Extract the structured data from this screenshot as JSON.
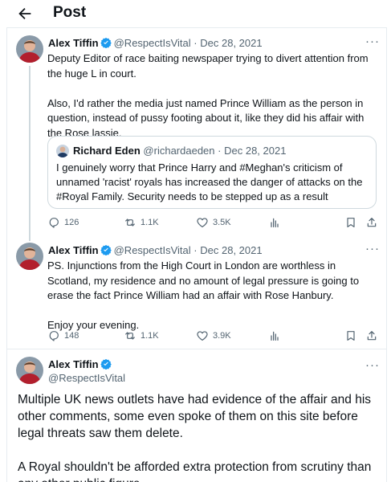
{
  "header": {
    "title": "Post"
  },
  "tweets": [
    {
      "name": "Alex Tiffin",
      "handle": "@RespectIsVital",
      "separator": "·",
      "date": "Dec 28, 2021",
      "text": "Deputy Editor of race baiting newspaper trying to divert attention from the huge L in court.\n\nAlso, I'd rather the media just named Prince William as the person in question, instead of pussy footing about it, like they did his affair with the Rose lassie.",
      "quote": {
        "name": "Richard Eden",
        "handle": "@richardaeden",
        "separator": "·",
        "date": "Dec 28, 2021",
        "text": "I genuinely worry that Prince Harry and #Meghan's criticism of unnamed 'racist' royals has increased the danger of attacks on the #Royal Family. Security needs to be stepped up as a result"
      },
      "stats": {
        "replies": "126",
        "reposts": "1.1K",
        "likes": "3.5K"
      }
    },
    {
      "name": "Alex Tiffin",
      "handle": "@RespectIsVital",
      "separator": "·",
      "date": "Dec 28, 2021",
      "text": "PS. Injunctions from the High Court in London are worthless in Scotland, my residence and no amount of legal pressure is going to erase the fact Prince William had an affair with Rose Hanbury.\n\nEnjoy your evening.",
      "stats": {
        "replies": "148",
        "reposts": "1.1K",
        "likes": "3.9K"
      }
    },
    {
      "name": "Alex Tiffin",
      "handle": "@RespectIsVital",
      "text": "Multiple UK news outlets have had evidence of the affair and his other comments, some even spoke of them on this site before legal threats saw them delete.\n\nA Royal shouldn't be afforded extra protection from scrutiny than any other public figure."
    }
  ],
  "colors": {
    "verified": "#1d9bf0",
    "text": "#0f1419",
    "secondary": "#536471",
    "border": "#e6ecf0"
  },
  "icons": [
    "back-arrow-icon",
    "verified-badge-icon",
    "more-icon",
    "reply-icon",
    "repost-icon",
    "like-icon",
    "views-icon",
    "bookmark-icon",
    "share-icon"
  ]
}
